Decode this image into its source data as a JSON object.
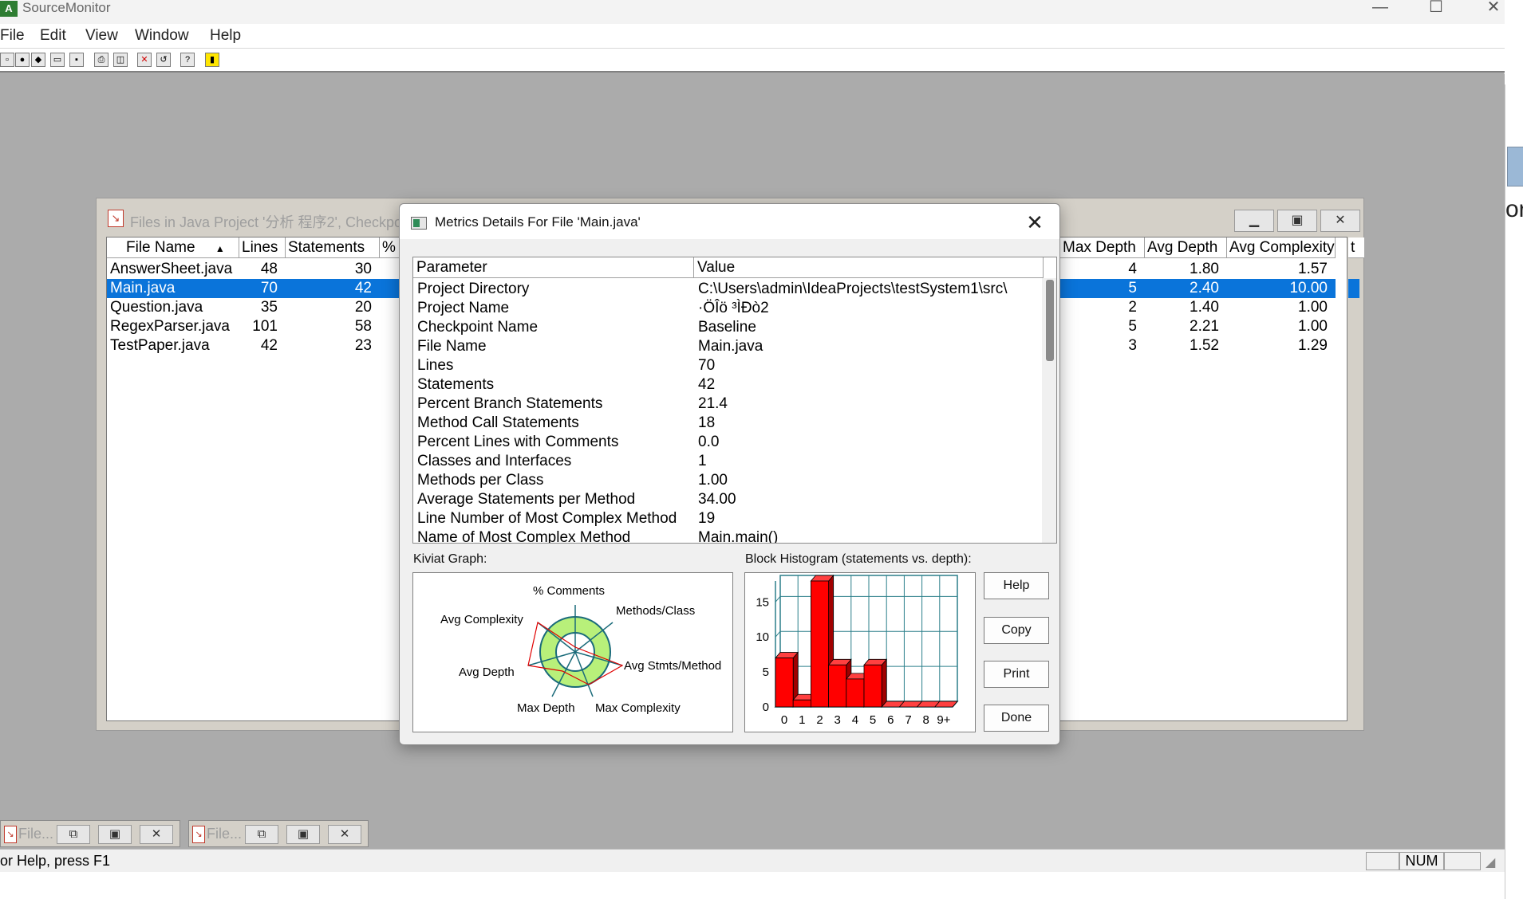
{
  "app": {
    "title": "SourceMonitor",
    "icon_label": "A",
    "window_buttons": {
      "minimize": "—",
      "maximize": "☐",
      "close": "✕"
    }
  },
  "menu": [
    "File",
    "Edit",
    "View",
    "Window",
    "Help"
  ],
  "files_window": {
    "title": "Files in Java Project '分析 程序2', Checkpoint 'Baseline'",
    "columns_left": [
      "File Name",
      "Lines",
      "Statements",
      "%"
    ],
    "columns_right": [
      "Max Depth",
      "Avg Depth",
      "Avg Complexity"
    ],
    "right_partial_header": "t",
    "rows": [
      {
        "name": "AnswerSheet.java",
        "lines": "48",
        "statements": "30",
        "max_depth": "4",
        "avg_depth": "1.80",
        "avg_complexity": "1.57"
      },
      {
        "name": "Main.java",
        "lines": "70",
        "statements": "42",
        "max_depth": "5",
        "avg_depth": "2.40",
        "avg_complexity": "10.00"
      },
      {
        "name": "Question.java",
        "lines": "35",
        "statements": "20",
        "max_depth": "2",
        "avg_depth": "1.40",
        "avg_complexity": "1.00"
      },
      {
        "name": "RegexParser.java",
        "lines": "101",
        "statements": "58",
        "max_depth": "5",
        "avg_depth": "2.21",
        "avg_complexity": "1.00"
      },
      {
        "name": "TestPaper.java",
        "lines": "42",
        "statements": "23",
        "max_depth": "3",
        "avg_depth": "1.52",
        "avg_complexity": "1.29"
      }
    ],
    "selected_row": 1
  },
  "dialog": {
    "title": "Metrics Details For File 'Main.java'",
    "columns": [
      "Parameter",
      "Value"
    ],
    "rows": [
      {
        "param": "Project Directory",
        "value": "C:\\Users\\admin\\IdeaProjects\\testSystem1\\src\\"
      },
      {
        "param": "Project Name",
        "value": "·ÖÎö ³ÌÐò2"
      },
      {
        "param": "Checkpoint Name",
        "value": "Baseline"
      },
      {
        "param": "File Name",
        "value": "Main.java"
      },
      {
        "param": "Lines",
        "value": "70"
      },
      {
        "param": "Statements",
        "value": "42"
      },
      {
        "param": "Percent Branch Statements",
        "value": "21.4"
      },
      {
        "param": "Method Call Statements",
        "value": "18"
      },
      {
        "param": "Percent Lines with Comments",
        "value": "0.0"
      },
      {
        "param": "Classes and Interfaces",
        "value": "1"
      },
      {
        "param": "Methods per Class",
        "value": "1.00"
      },
      {
        "param": "Average Statements per Method",
        "value": "34.00"
      },
      {
        "param": "Line Number of Most Complex Method",
        "value": "19"
      },
      {
        "param": "Name of Most Complex Method",
        "value": "Main.main()"
      }
    ],
    "kiviat_caption": "Kiviat Graph:",
    "histogram_caption": "Block Histogram (statements vs. depth):",
    "kiviat_labels": [
      "% Comments",
      "Methods/Class",
      "Avg Stmts/Method",
      "Max Complexity",
      "Max Depth",
      "Avg Depth",
      "Avg Complexity"
    ],
    "buttons": [
      "Help",
      "Copy",
      "Print",
      "Done"
    ]
  },
  "chart_data": {
    "type": "bar",
    "title": "Block Histogram (statements vs. depth):",
    "categories": [
      "0",
      "1",
      "2",
      "3",
      "4",
      "5",
      "6",
      "7",
      "8",
      "9+"
    ],
    "values": [
      7,
      1,
      18,
      6,
      4,
      6,
      0,
      0,
      0,
      0
    ],
    "yticks": [
      "0",
      "5",
      "10",
      "15"
    ],
    "ylim": [
      0,
      18
    ],
    "grid": true,
    "bar_color": "#ff0000"
  },
  "minimized": [
    {
      "label": "File..."
    },
    {
      "label": "File..."
    }
  ],
  "statusbar": {
    "text": "or Help, press F1",
    "num": "NUM"
  },
  "right_sliver": {
    "text": "or"
  },
  "colors": {
    "selection": "#0a74da",
    "mdi_background": "#ababab",
    "bar": "#ff0000"
  }
}
